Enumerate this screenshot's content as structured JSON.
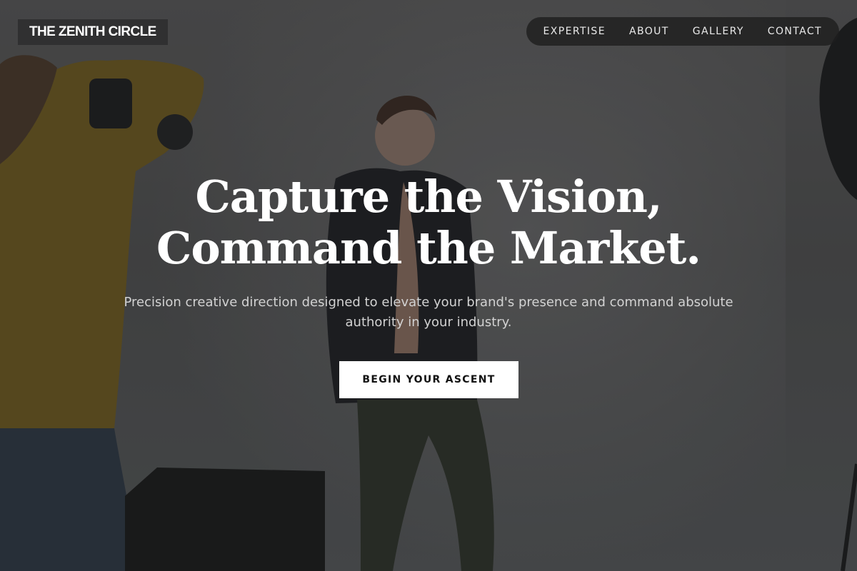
{
  "brand": {
    "logo_text": "THE ZENITH CIRCLE"
  },
  "nav": {
    "items": [
      {
        "label": "EXPERTISE"
      },
      {
        "label": "ABOUT"
      },
      {
        "label": "GALLERY"
      },
      {
        "label": "CONTACT"
      }
    ]
  },
  "hero": {
    "headline_line1": "Capture the Vision,",
    "headline_line2": "Command the Market.",
    "subtitle": "Precision creative direction designed to elevate your brand's presence and command absolute authority in your industry.",
    "cta_label": "BEGIN YOUR ASCENT"
  },
  "colors": {
    "overlay": "#1c1c1e",
    "logo_background": "#303031",
    "nav_background": "#1e1e1f",
    "cta_background": "#ffffff",
    "accent_shirt": "#b48a1c"
  },
  "background_image": "photo-studio-shoot"
}
